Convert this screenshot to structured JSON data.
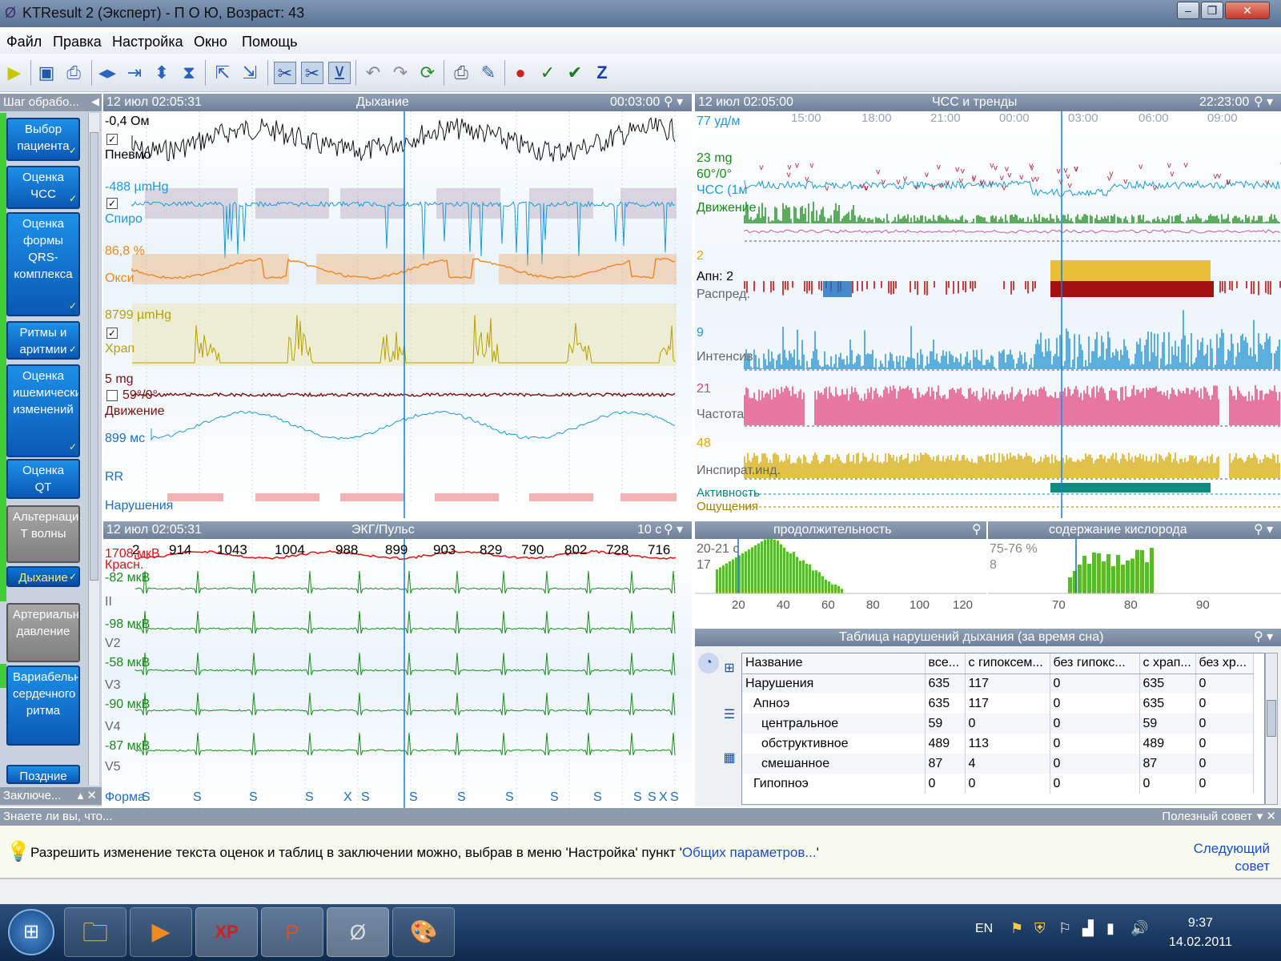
{
  "window": {
    "title": "KTResult 2 (Эксперт)  - П О Ю,  Возраст: 43",
    "min": "–",
    "max": "❐",
    "close": "✕"
  },
  "menu": [
    "Файл",
    "Правка",
    "Настройка",
    "Окно",
    "Помощь"
  ],
  "toolbar": {
    "z_label": "Z"
  },
  "left_panel": {
    "header": "Шаг обрабо...",
    "steps": [
      {
        "label": "Выбор пациента",
        "checked": true
      },
      {
        "label": "Оценка ЧСС",
        "checked": true
      },
      {
        "label": "Оценка формы QRS-комплекса",
        "checked": true
      },
      {
        "label": "Ритмы и аритмии",
        "checked": true
      },
      {
        "label": "Оценка ишемических изменений",
        "checked": true
      },
      {
        "label": "Оценка QT",
        "checked": false
      },
      {
        "label": "Альтернация Т волны",
        "checked": false
      },
      {
        "label": "Дыхание",
        "checked": true
      },
      {
        "label": "Артериальное давление",
        "checked": false
      },
      {
        "label": "Вариабельность сердечного ритма",
        "checked": false
      },
      {
        "label": "Поздние",
        "checked": false
      }
    ],
    "footer": "Заключе..."
  },
  "breath_panel": {
    "time": "12 июл 02:05:31",
    "title": "Дыхание",
    "duration": "00:03:00",
    "channels": {
      "pnevmo_val": "-0,4 Ом",
      "pnevmo": "Пневмо",
      "spiro_val": "-488 µmHg",
      "spiro": "Спиро",
      "oxi_val": "86,8 %",
      "oxi": "Окси",
      "hrap_val": "8799 µmHg",
      "hrap": "Храп",
      "move_val": "5 mg",
      "move_angle": "59°/0°",
      "move": "Движение",
      "rr_val": "899 мс",
      "rr": "RR",
      "viol": "Нарушения"
    }
  },
  "ecg_panel": {
    "time": "12 июл 02:05:31",
    "title": "ЭКГ/Пульс",
    "duration": "10 с",
    "rr_values": [
      "2",
      "914",
      "1043",
      "1004",
      "988",
      "899",
      "903",
      "829",
      "790",
      "802",
      "728",
      "716"
    ],
    "channels": [
      {
        "val": "1708 мкВ",
        "name": "Красн."
      },
      {
        "val": "-82 мкВ",
        "name": "II"
      },
      {
        "val": "-98 мкВ",
        "name": "V2"
      },
      {
        "val": "-58 мкВ",
        "name": "V3"
      },
      {
        "val": "-90 мкВ",
        "name": "V4"
      },
      {
        "val": "-87 мкВ",
        "name": "V5"
      }
    ],
    "forma": "Форма",
    "beat_labels": [
      "S",
      "S",
      "S",
      "S",
      "X",
      "S",
      "S",
      "S",
      "S",
      "S",
      "S",
      "S",
      "S",
      "X",
      "S"
    ]
  },
  "trends_panel": {
    "time": "12 июл 02:05:00",
    "title": "ЧСС и тренды",
    "duration": "22:23:00",
    "time_ticks": [
      "15:00",
      "18:00",
      "21:00",
      "00:00",
      "03:00",
      "06:00",
      "09:00"
    ],
    "labels": {
      "hr_val": "77 уд/м",
      "mg": "23 mg",
      "angle": "60°/0°",
      "hr": "ЧСС (1м",
      "move": "Движение",
      "apn_val": "2",
      "apn": "Апн: 2",
      "raspred": "Распред.",
      "int_val": "9",
      "int": "Интенсив",
      "freq_val": "21",
      "freq": "Частота",
      "insp_val": "48",
      "insp": "Инспират.инд.",
      "act": "Активность",
      "feel": "Ощущения"
    }
  },
  "hist_duration": {
    "title": "продолжительность",
    "label": "20-21 с",
    "count": "17",
    "ticks": [
      "20",
      "40",
      "60",
      "80",
      "100",
      "120"
    ]
  },
  "hist_oxygen": {
    "title": "содержание кислорода",
    "label": "75-76 %",
    "count": "8",
    "ticks": [
      "70",
      "80",
      "90"
    ]
  },
  "violations_table": {
    "title": "Таблица нарушений дыхания (за время сна)",
    "columns": [
      "Название",
      "все...",
      "с гипоксем...",
      "без гипокс...",
      "с храп...",
      "без хр..."
    ],
    "rows": [
      [
        "Нарушения",
        "635",
        "117",
        "0",
        "635",
        "0"
      ],
      [
        "Апноэ",
        "635",
        "117",
        "0",
        "635",
        "0"
      ],
      [
        "центральное",
        "59",
        "0",
        "0",
        "59",
        "0"
      ],
      [
        "обструктивное",
        "489",
        "113",
        "0",
        "489",
        "0"
      ],
      [
        "смешанное",
        "87",
        "4",
        "0",
        "87",
        "0"
      ],
      [
        "Гипопноэ",
        "0",
        "0",
        "0",
        "0",
        "0"
      ]
    ]
  },
  "tips": {
    "header": "Знаете ли вы, что...",
    "right": "Полезный совет",
    "text": "Разрешить изменение текста оценок и таблиц в заключении можно, выбрав в меню 'Настройка' пункт '",
    "link": "Общих параметров...",
    "text_end": "'",
    "next1": "Следующий",
    "next2": "совет"
  },
  "taskbar": {
    "lang": "EN",
    "time": "9:37",
    "date": "14.02.2011"
  }
}
